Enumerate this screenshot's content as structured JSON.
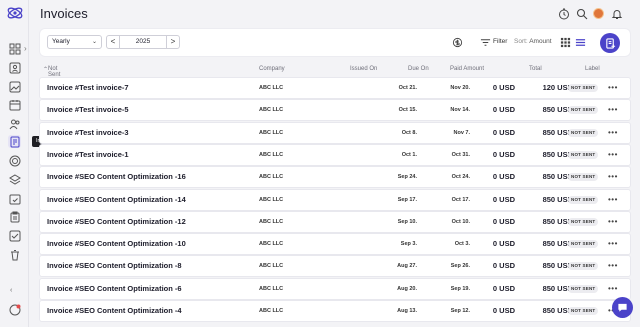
{
  "header": {
    "title": "Invoices",
    "icons": [
      "timer-icon",
      "search-icon",
      "avatar",
      "bell-icon"
    ]
  },
  "sidebar": {
    "tooltip": "Invoices",
    "items": [
      {
        "icon": "dashboard-icon"
      },
      {
        "icon": "contacts-icon"
      },
      {
        "icon": "gallery-icon"
      },
      {
        "icon": "calendar-icon"
      },
      {
        "icon": "team-icon"
      },
      {
        "icon": "invoice-icon",
        "active": true
      },
      {
        "icon": "target-icon"
      },
      {
        "icon": "layers-icon"
      },
      {
        "icon": "calendar-check-icon"
      },
      {
        "icon": "clipboard-icon"
      },
      {
        "icon": "checklist-icon"
      },
      {
        "icon": "trash-icon"
      }
    ]
  },
  "toolbar": {
    "period": "Yearly",
    "prev": "<",
    "year": "2025",
    "next": ">",
    "filter_label": "Filter",
    "sort_prefix": "Sort:",
    "sort_value": "Amount"
  },
  "table": {
    "group_label": "Not Sent (45)",
    "columns": {
      "company": "Company",
      "issued": "Issued On",
      "due": "Due On",
      "paid": "Paid Amount",
      "total": "Total",
      "label": "Label"
    },
    "rows": [
      {
        "name": "Invoice #Test invoice-7",
        "company": "ABC LLC",
        "issued": "Oct 21.",
        "due": "Nov 20.",
        "paid": "0 USD",
        "total": "120 USD",
        "label": "NOT SENT"
      },
      {
        "name": "Invoice #Test invoice-5",
        "company": "ABC LLC",
        "issued": "Oct 15.",
        "due": "Nov 14.",
        "paid": "0 USD",
        "total": "850 USD",
        "label": "NOT SENT"
      },
      {
        "name": "Invoice #Test invoice-3",
        "company": "ABC LLC",
        "issued": "Oct 8.",
        "due": "Nov 7.",
        "paid": "0 USD",
        "total": "850 USD",
        "label": "NOT SENT"
      },
      {
        "name": "Invoice #Test invoice-1",
        "company": "ABC LLC",
        "issued": "Oct 1.",
        "due": "Oct 31.",
        "paid": "0 USD",
        "total": "850 USD",
        "label": "NOT SENT"
      },
      {
        "name": "Invoice #SEO Content Optimization -16",
        "company": "ABC LLC",
        "issued": "Sep 24.",
        "due": "Oct 24.",
        "paid": "0 USD",
        "total": "850 USD",
        "label": "NOT SENT"
      },
      {
        "name": "Invoice #SEO Content Optimization -14",
        "company": "ABC LLC",
        "issued": "Sep 17.",
        "due": "Oct 17.",
        "paid": "0 USD",
        "total": "850 USD",
        "label": "NOT SENT"
      },
      {
        "name": "Invoice #SEO Content Optimization -12",
        "company": "ABC LLC",
        "issued": "Sep 10.",
        "due": "Oct 10.",
        "paid": "0 USD",
        "total": "850 USD",
        "label": "NOT SENT"
      },
      {
        "name": "Invoice #SEO Content Optimization -10",
        "company": "ABC LLC",
        "issued": "Sep 3.",
        "due": "Oct 3.",
        "paid": "0 USD",
        "total": "850 USD",
        "label": "NOT SENT"
      },
      {
        "name": "Invoice #SEO Content Optimization -8",
        "company": "ABC LLC",
        "issued": "Aug 27.",
        "due": "Sep 26.",
        "paid": "0 USD",
        "total": "850 USD",
        "label": "NOT SENT"
      },
      {
        "name": "Invoice #SEO Content Optimization -6",
        "company": "ABC LLC",
        "issued": "Aug 20.",
        "due": "Sep 19.",
        "paid": "0 USD",
        "total": "850 USD",
        "label": "NOT SENT"
      },
      {
        "name": "Invoice #SEO Content Optimization -4",
        "company": "ABC LLC",
        "issued": "Aug 13.",
        "due": "Sep 12.",
        "paid": "0 USD",
        "total": "850 USD",
        "label": "NOT SENT"
      }
    ]
  },
  "colors": {
    "accent": "#4b43c9",
    "badge_bg": "#ececf0",
    "background": "#f3f3f6"
  }
}
